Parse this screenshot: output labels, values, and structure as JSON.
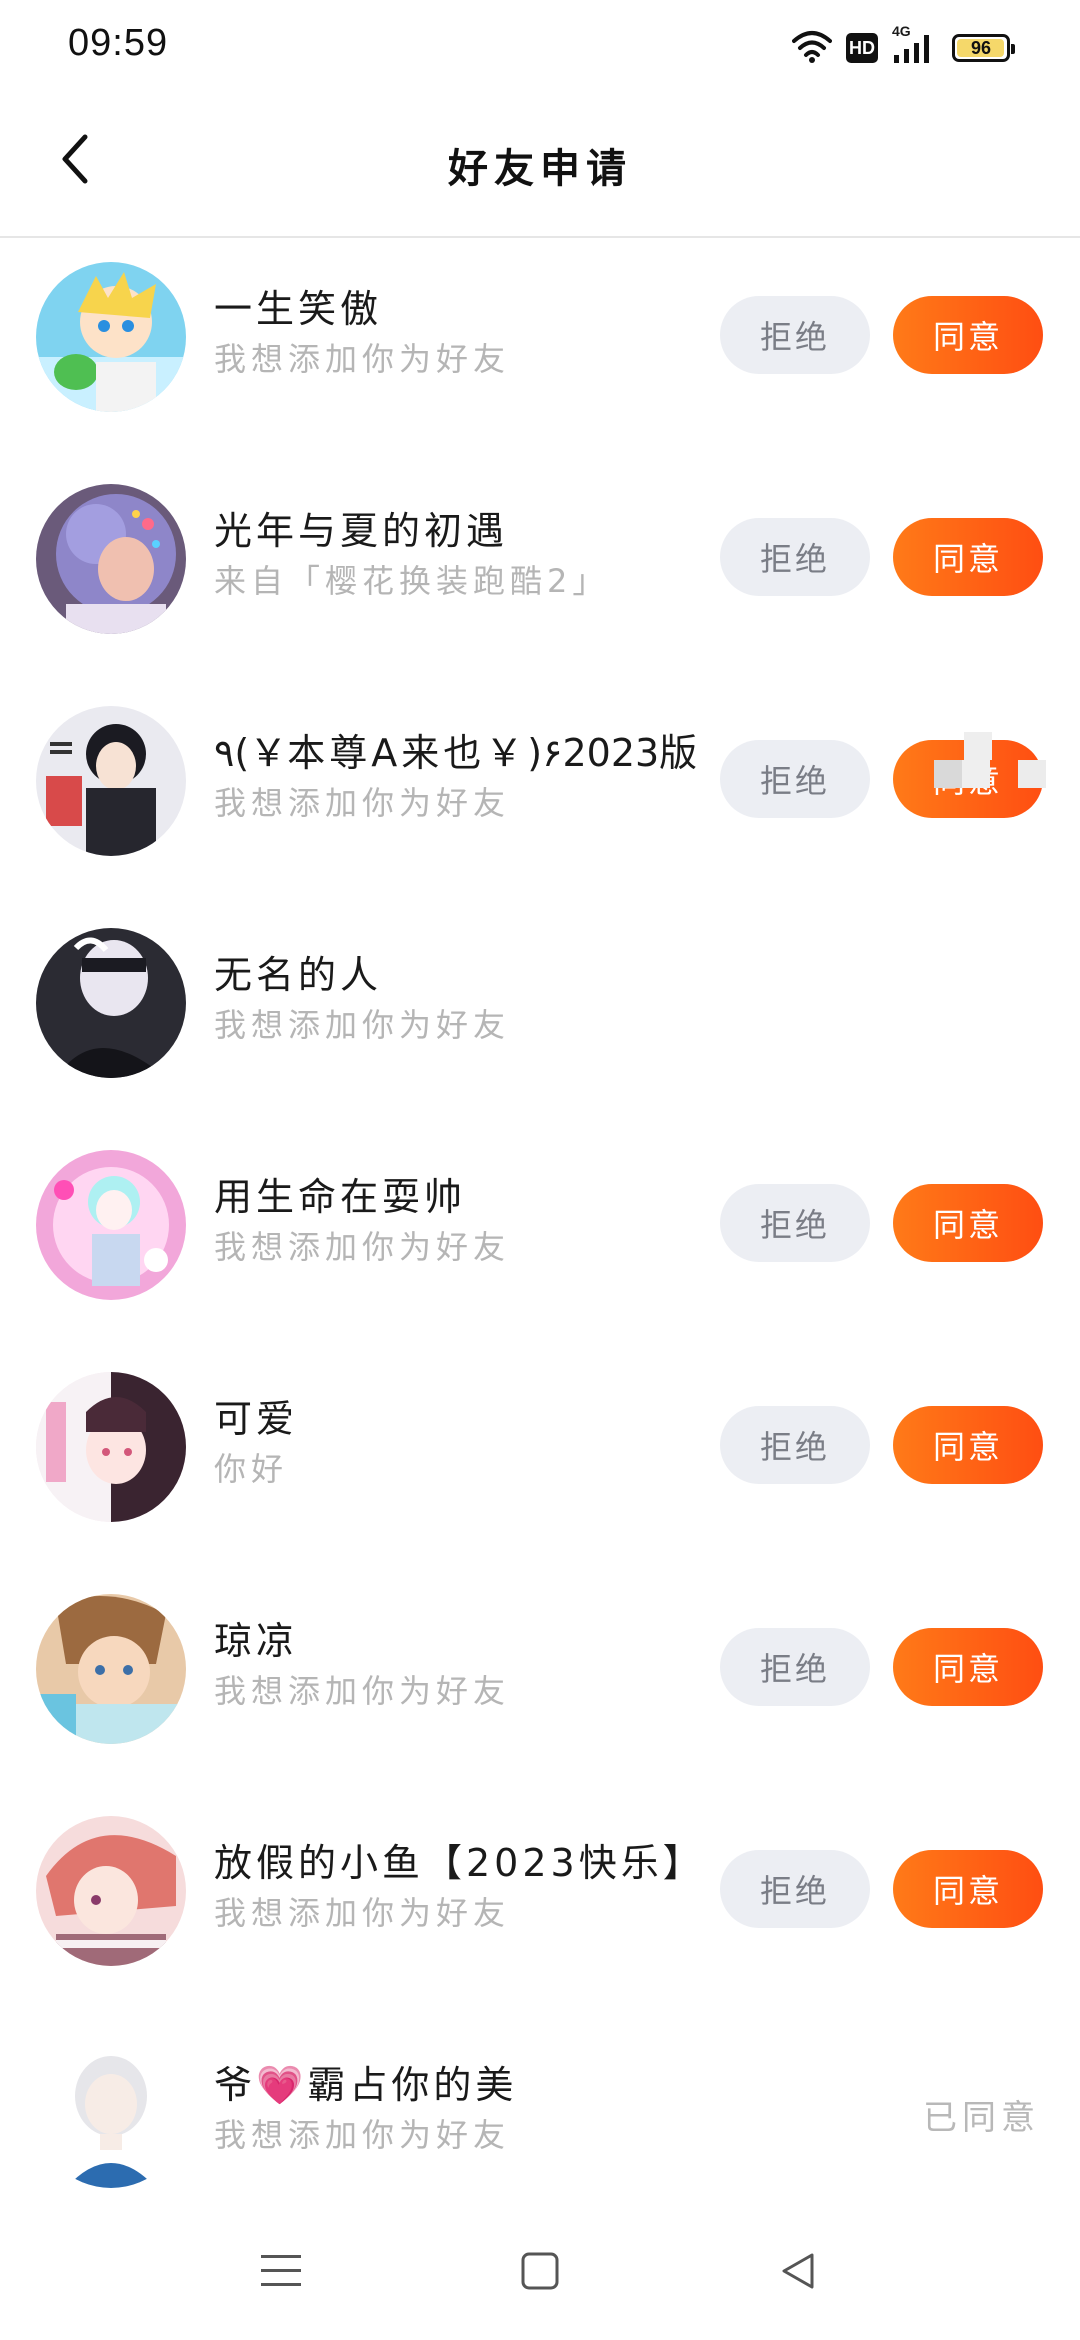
{
  "status_bar": {
    "time": "09:59",
    "hd_label": "HD",
    "network_label": "4G",
    "battery_level": "96",
    "icons": [
      "wifi-icon",
      "hd-icon",
      "signal-4g-icon",
      "battery-icon"
    ]
  },
  "header": {
    "title": "好友申请",
    "back_icon": "chevron-left-icon"
  },
  "actions": {
    "reject_label": "拒绝",
    "accept_label": "同意"
  },
  "requests": [
    {
      "name": "一生笑傲",
      "message": "我想添加你为好友",
      "state": "pending"
    },
    {
      "name": "光年与夏的初遇",
      "message": "来自「樱花换装跑酷2」",
      "state": "pending"
    },
    {
      "name": "٩(￥本尊A来也￥)۶2023版",
      "message": "我想添加你为好友",
      "state": "pending"
    },
    {
      "name": "无名的人",
      "message": "我想添加你为好友",
      "state": "loading"
    },
    {
      "name": "用生命在耍帅",
      "message": "我想添加你为好友",
      "state": "pending"
    },
    {
      "name": "可爱",
      "message": "你好",
      "state": "pending"
    },
    {
      "name": "琼凉",
      "message": "我想添加你为好友",
      "state": "pending"
    },
    {
      "name": "放假的小鱼【2023快乐】",
      "message": "我想添加你为好友",
      "state": "pending"
    },
    {
      "name": "爷💗霸占你的美",
      "message": "我想添加你为好友",
      "state": "accepted",
      "status_text": "已同意"
    }
  ],
  "nav": {
    "icons": [
      "menu-icon",
      "home-square-icon",
      "back-triangle-icon"
    ]
  },
  "colors": {
    "accent_start": "#ff7a18",
    "accent_end": "#ff4e12",
    "reject_bg": "#eceef3",
    "secondary_text": "#b5b5b5"
  }
}
